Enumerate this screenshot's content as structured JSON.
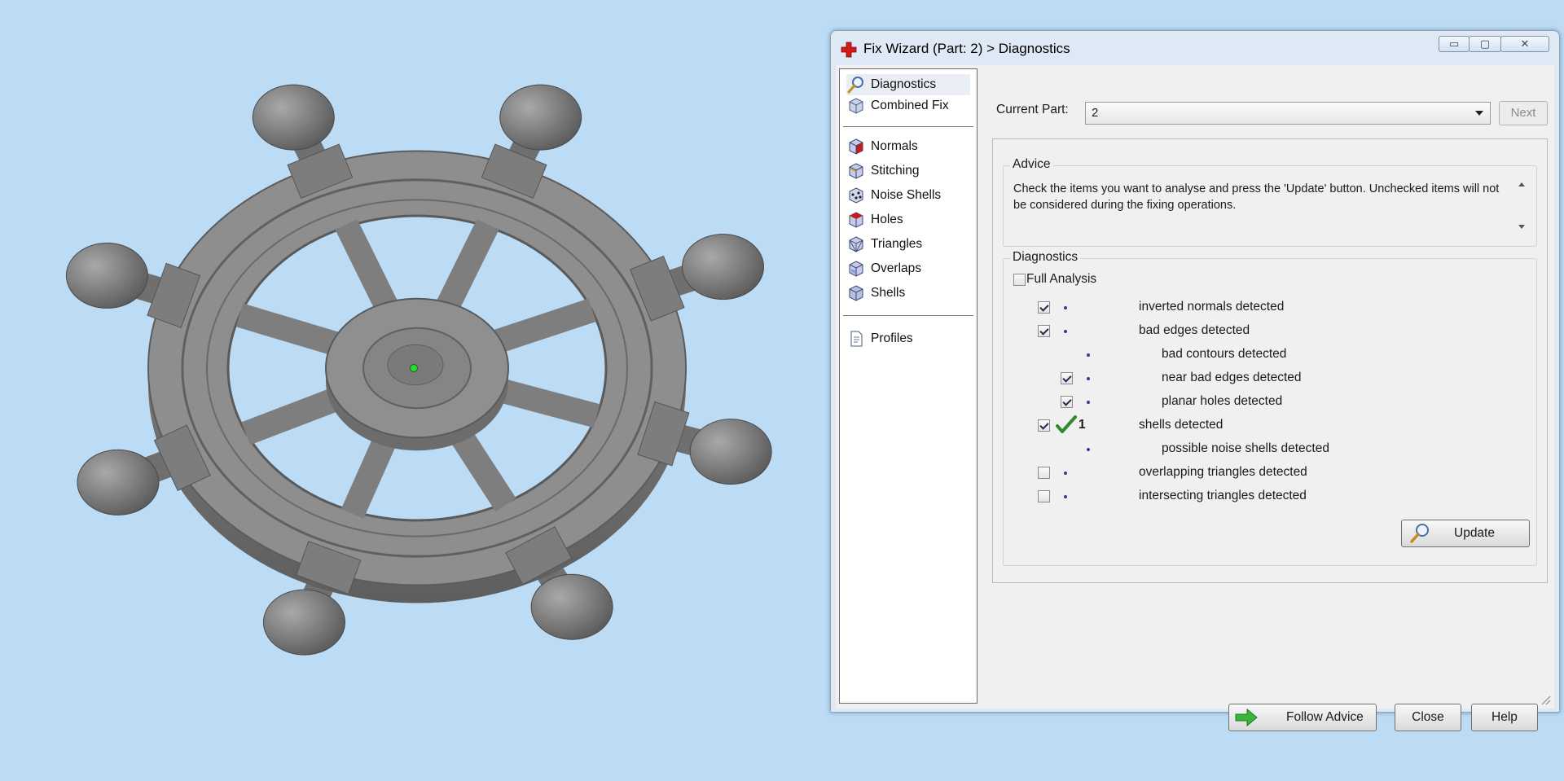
{
  "window": {
    "title": "Fix Wizard (Part: 2) > Diagnostics",
    "controls": {
      "minimize": "▭",
      "maximize": "▢",
      "close": "✕"
    }
  },
  "nav": {
    "top_items": [
      {
        "label": "Diagnostics",
        "icon": "magnifier-icon",
        "selected": true
      },
      {
        "label": "Combined Fix",
        "icon": "cube-icon",
        "selected": false
      }
    ],
    "fix_items": [
      {
        "label": "Normals",
        "icon": "normals-cube-icon"
      },
      {
        "label": "Stitching",
        "icon": "stitching-cube-icon"
      },
      {
        "label": "Noise Shells",
        "icon": "noise-shells-icon"
      },
      {
        "label": "Holes",
        "icon": "holes-cube-icon"
      },
      {
        "label": "Triangles",
        "icon": "triangles-cube-icon"
      },
      {
        "label": "Overlaps",
        "icon": "overlaps-cube-icon"
      },
      {
        "label": "Shells",
        "icon": "shells-cube-icon"
      }
    ],
    "profiles_label": "Profiles"
  },
  "current_part": {
    "label": "Current Part:",
    "value": "2",
    "next_label": "Next"
  },
  "advice": {
    "legend": "Advice",
    "text": "Check the items you want to analyse and press the 'Update' button. Unchecked items will not be considered during the fixing operations."
  },
  "diagnostics": {
    "legend": "Diagnostics",
    "full_analysis_label": "Full Analysis",
    "full_analysis_checked": false,
    "rows": [
      {
        "label": "inverted normals detected",
        "checked": true,
        "has_checkbox": true,
        "indent": 0,
        "count": "",
        "ok": false
      },
      {
        "label": "bad edges detected",
        "checked": true,
        "has_checkbox": true,
        "indent": 0,
        "count": "",
        "ok": false
      },
      {
        "label": "bad contours detected",
        "checked": false,
        "has_checkbox": false,
        "indent": 1,
        "count": "",
        "ok": false
      },
      {
        "label": "near bad edges detected",
        "checked": true,
        "has_checkbox": true,
        "indent": 1,
        "count": "",
        "ok": false
      },
      {
        "label": "planar holes detected",
        "checked": true,
        "has_checkbox": true,
        "indent": 1,
        "count": "",
        "ok": false
      },
      {
        "label": "shells detected",
        "checked": true,
        "has_checkbox": true,
        "indent": 0,
        "count": "1",
        "ok": true
      },
      {
        "label": "possible noise shells detected",
        "checked": false,
        "has_checkbox": false,
        "indent": 1,
        "count": "",
        "ok": false
      },
      {
        "label": "overlapping triangles detected",
        "checked": false,
        "has_checkbox": true,
        "indent": 0,
        "count": "",
        "ok": false
      },
      {
        "label": "intersecting triangles detected",
        "checked": false,
        "has_checkbox": true,
        "indent": 0,
        "count": "",
        "ok": false
      }
    ],
    "update_label": "Update"
  },
  "buttons": {
    "follow_advice": "Follow Advice",
    "close": "Close",
    "help": "Help"
  },
  "colors": {
    "viewport_bg": "#bcdcf6",
    "model_gray": "#8c8c8c",
    "ok_green": "#2e8b2e",
    "status_dot": "#2c3e95"
  }
}
